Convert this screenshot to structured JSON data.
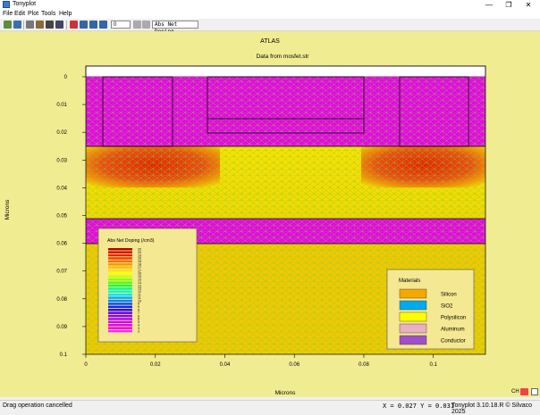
{
  "window": {
    "title": "Tonyplot",
    "minimize_glyph": "—",
    "maximize_glyph": "❐",
    "close_glyph": "✕"
  },
  "menu": {
    "items": [
      "File",
      "Edit",
      "Plot",
      "Tools",
      "Help"
    ]
  },
  "toolbar": {
    "icons": [
      "load-icon",
      "save-icon",
      "print-icon",
      "overlay-icon",
      "copy-icon",
      "duplicate-icon",
      "pan-icon",
      "zoom-in-icon",
      "zoom-out-icon",
      "zoom-box-icon",
      "zoom-back-icon",
      "zoom-forward-icon",
      "reset-icon"
    ],
    "zoom_level": "0",
    "quantity_selected": "Abs Net Doping"
  },
  "plot": {
    "header": "ATLAS",
    "title": "Data from mosfet.str",
    "xlabel": "Microns",
    "ylabel": "Microns",
    "x_ticks": [
      "0",
      "0.02",
      "0.04",
      "0.06",
      "0.08",
      "0.1"
    ],
    "y_ticks": [
      "0",
      "0.01",
      "0.02",
      "0.03",
      "0.04",
      "0.05",
      "0.06",
      "0.07",
      "0.08",
      "0.09",
      "0.1"
    ],
    "xlim": [
      0,
      0.115
    ],
    "ylim": [
      0.1,
      -0.003
    ]
  },
  "doping_legend": {
    "title": "Abs Net Doping (/cm3)",
    "values": [
      "20",
      "20",
      "19",
      "19",
      "18",
      "18",
      "17",
      "17",
      "16",
      "15",
      "15",
      "14",
      "13",
      "13",
      "12",
      "11",
      "11",
      "10",
      "9",
      "9",
      "8",
      "7",
      "6",
      "6",
      "5",
      "4",
      "3",
      "3"
    ],
    "colors": [
      "#b80000",
      "#d01000",
      "#e82000",
      "#f84000",
      "#ff6a00",
      "#ff9400",
      "#ffbe00",
      "#ffe000",
      "#f8ff00",
      "#c8ff00",
      "#90ff00",
      "#50ff10",
      "#10ff40",
      "#00ff90",
      "#00ffd0",
      "#00e0ff",
      "#00b0ff",
      "#0080ff",
      "#0050ff",
      "#1020ff",
      "#3000ff",
      "#6000ff",
      "#8800ff",
      "#b000ff",
      "#d000f8",
      "#e800f0",
      "#f800e8",
      "#ff20ff"
    ]
  },
  "materials_legend": {
    "title": "Materials",
    "items": [
      {
        "label": "Silicon",
        "color": "#f5a800"
      },
      {
        "label": "SiO2",
        "color": "#00aaee"
      },
      {
        "label": "Polysilicon",
        "color": "#ffff00"
      },
      {
        "label": "Aluminum",
        "color": "#e8b0c0"
      },
      {
        "label": "Conductor",
        "color": "#a050c8"
      }
    ]
  },
  "status": {
    "message": "Drag operation cancelled",
    "coords": "X = 0.027 Y = 0.031",
    "version": "Tonyplot 3.10.18.R © Silvaco 2025",
    "tray_lang": "CH"
  }
}
